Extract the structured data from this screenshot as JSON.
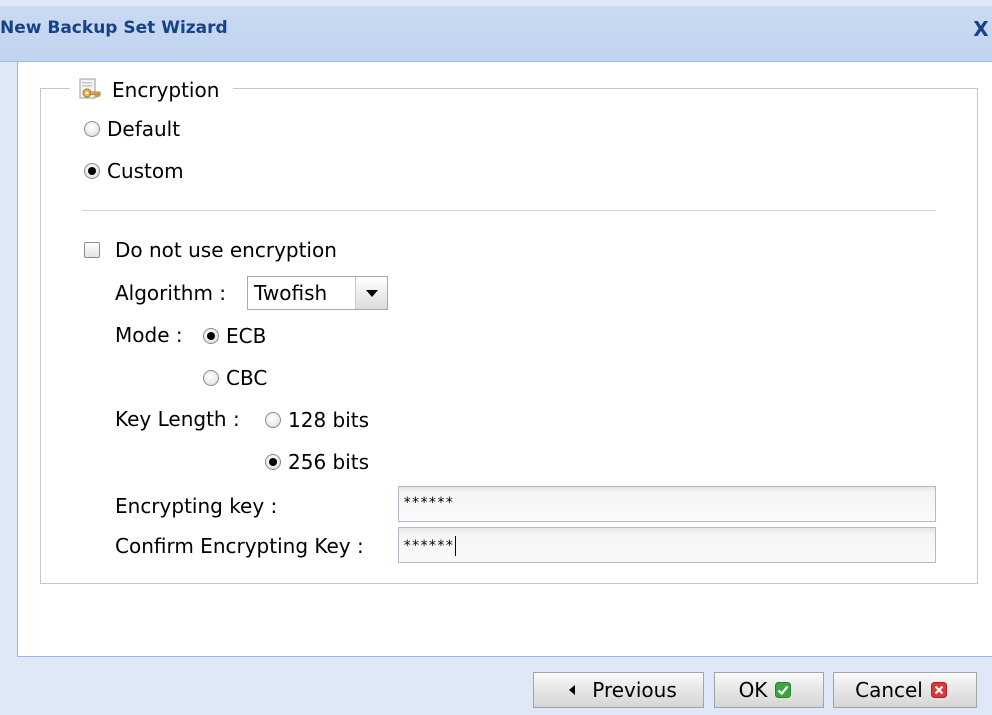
{
  "window": {
    "title": "New Backup Set Wizard",
    "close_label": "X"
  },
  "encryption": {
    "legend": "Encryption",
    "options": [
      {
        "label": "Default",
        "checked": false
      },
      {
        "label": "Custom",
        "checked": true
      }
    ],
    "no_encryption": {
      "label": "Do not use encryption",
      "checked": false
    },
    "algorithm": {
      "label": "Algorithm :",
      "value": "Twofish"
    },
    "mode": {
      "label": "Mode :",
      "options": [
        {
          "label": "ECB",
          "checked": true
        },
        {
          "label": "CBC",
          "checked": false
        }
      ]
    },
    "key_length": {
      "label": "Key Length :",
      "options": [
        {
          "label": "128 bits",
          "checked": false
        },
        {
          "label": "256 bits",
          "checked": true
        }
      ]
    },
    "encrypting_key": {
      "label": "Encrypting key :",
      "value": "******"
    },
    "confirm_key": {
      "label": "Confirm Encrypting Key :",
      "value": "******"
    }
  },
  "buttons": {
    "previous": "Previous",
    "ok": "OK",
    "cancel": "Cancel"
  },
  "colors": {
    "title_text": "#15428b",
    "ok_check": "#3fa540",
    "cancel_x": "#d9393b"
  }
}
